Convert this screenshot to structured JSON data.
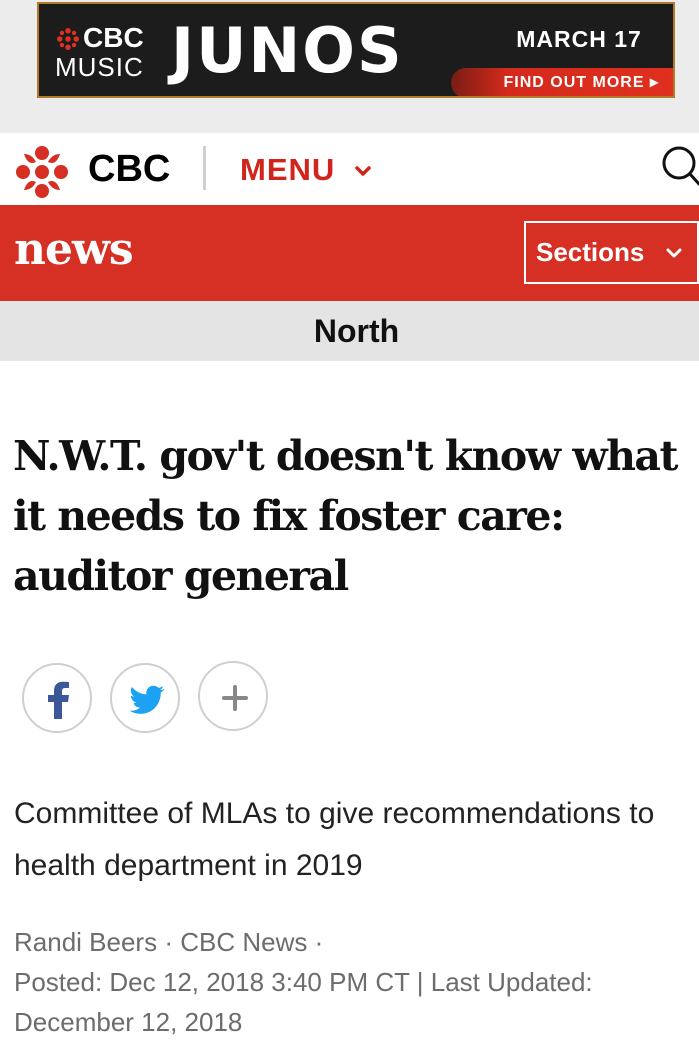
{
  "ad": {
    "brand_top": "CBC",
    "brand_bottom": "MUSIC",
    "event": "JUNOS",
    "date": "MARCH 17",
    "cta": "FIND OUT MORE"
  },
  "header": {
    "brand": "CBC",
    "menu_label": "MENU",
    "icons": [
      "cbc-gem-icon",
      "chevron-down-icon",
      "search-icon"
    ]
  },
  "newsbar": {
    "title": "news",
    "sections_label": "Sections"
  },
  "section": {
    "name": "North"
  },
  "article": {
    "headline": "N.W.T. gov't doesn't know what it needs to fix foster care: auditor general",
    "share_icons": [
      "facebook-icon",
      "twitter-icon",
      "plus-icon"
    ],
    "deck": "Committee of MLAs to give recommendations to health department in 2019",
    "author": "Randi Beers",
    "separator": "·",
    "outlet": "CBC News",
    "posted": "Posted: Dec 12, 2018 3:40 PM CT",
    "pipe": "|",
    "updated": "Last Updated: December 12, 2018"
  },
  "colors": {
    "cbc_red": "#d62f23",
    "menu_red": "#d0241c",
    "ad_background": "#1c1c1c",
    "section_bar": "#e4e4e4"
  }
}
